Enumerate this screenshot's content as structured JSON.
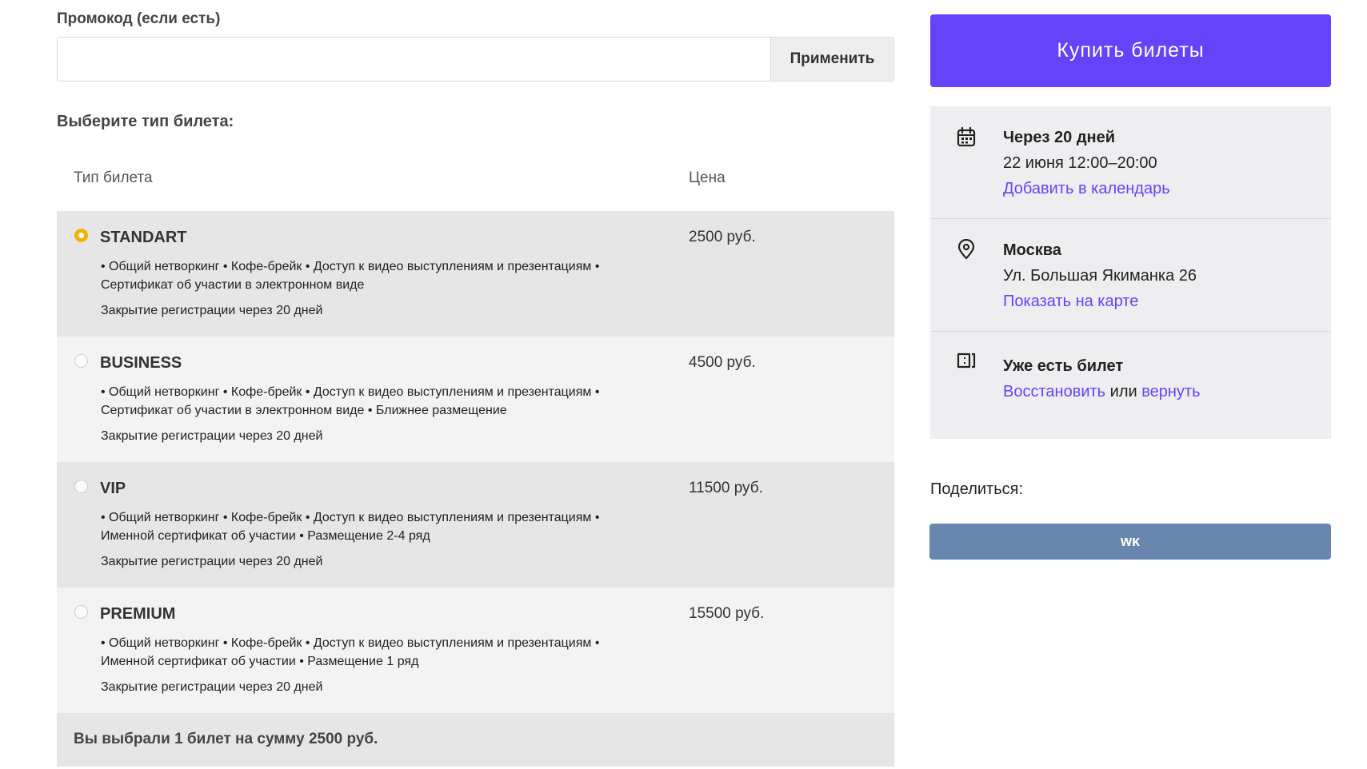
{
  "promo": {
    "label": "Промокод (если есть)",
    "value": "",
    "placeholder": "",
    "apply_label": "Применить"
  },
  "tickets_section": {
    "title": "Выберите тип билета:",
    "col_type": "Тип билета",
    "col_price": "Цена"
  },
  "tickets": [
    {
      "name": "STANDART",
      "selected": true,
      "desc_line1": "• Общий нетворкинг • Кофе-брейк • Доступ к видео выступлениям и презентациям •",
      "desc_line2": "Сертификат об участии в электронном виде",
      "closing": "Закрытие регистрации через 20 дней",
      "price": "2500 руб."
    },
    {
      "name": "BUSINESS",
      "selected": false,
      "desc_line1": "• Общий нетворкинг • Кофе-брейк • Доступ к видео выступлениям и презентациям •",
      "desc_line2": "Сертификат об участии в электронном виде • Ближнее размещение",
      "closing": "Закрытие регистрации через 20 дней",
      "price": "4500 руб."
    },
    {
      "name": "VIP",
      "selected": false,
      "desc_line1": "• Общий нетворкинг • Кофе-брейк • Доступ к видео выступлениям и презентациям •",
      "desc_line2": "Именной сертификат об участии • Размещение 2-4 ряд",
      "closing": "Закрытие регистрации через 20 дней",
      "price": "11500 руб."
    },
    {
      "name": "PREMIUM",
      "selected": false,
      "desc_line1": "• Общий нетворкинг • Кофе-брейк • Доступ к видео выступлениям и презентациям •",
      "desc_line2": "Именной сертификат об участии • Размещение 1 ряд",
      "closing": "Закрытие регистрации через 20 дней",
      "price": "15500 руб."
    }
  ],
  "summary": "Вы выбрали 1 билет на сумму 2500 руб.",
  "sidebar": {
    "buy_label": "Купить  билеты",
    "date": {
      "icon": "calendar-icon",
      "title": "Через 20 дней",
      "when": "22 июня 12:00–20:00",
      "link": "Добавить в календарь"
    },
    "location": {
      "icon": "map-pin-icon",
      "title": "Москва",
      "address": "Ул. Большая Якиманка 26",
      "link": "Показать на карте"
    },
    "have_ticket": {
      "icon": "ticket-icon",
      "title": "Уже есть билет",
      "restore": "Восстановить",
      "or": "или",
      "return": "вернуть"
    },
    "share_label": "Поделиться:",
    "vk_label": "ᴡᴋ"
  },
  "colors": {
    "accent": "#6443fb",
    "radio_selected": "#f5b300",
    "vk": "#6787ae"
  }
}
